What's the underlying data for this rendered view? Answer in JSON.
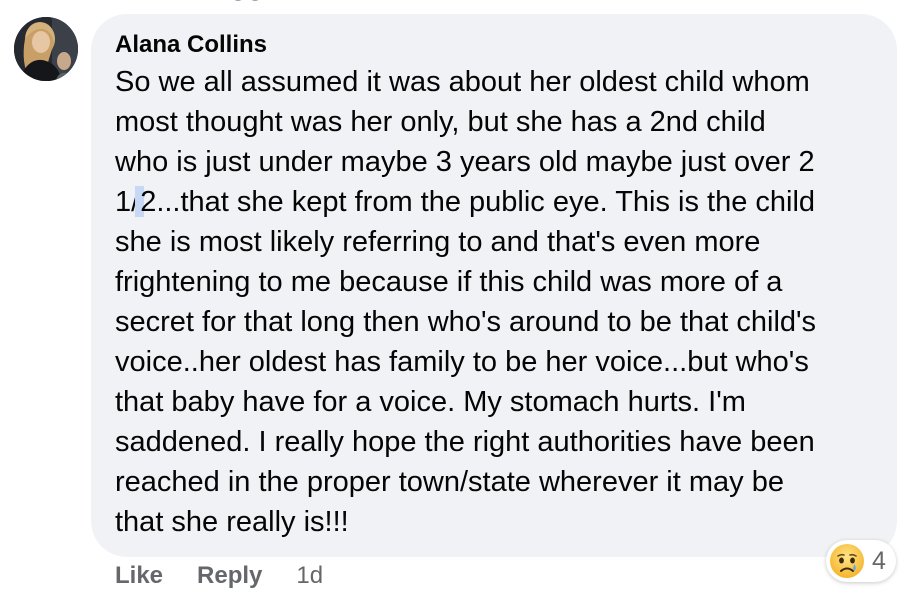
{
  "comment": {
    "author": "Alana Collins",
    "text_lines": [
      "So we all assumed it was about her oldest child whom",
      "most thought was her only, but she has a 2nd child",
      "who is just under maybe 3 years old maybe just over 2",
      "1/",
      "2...that she kept from the public eye. This is the child",
      "she is most likely referring to and that's even more",
      "frightening to me because if this child was more of a",
      "secret for that long then who's around to be that child's",
      "voice..her oldest has family to be her voice...but who's",
      "that baby have for a voice. My stomach hurts. I'm",
      "saddened. I really hope the right authorities have been",
      "reached in the proper town/state wherever it may be",
      "that she really is!!!"
    ]
  },
  "actions": {
    "like_label": "Like",
    "reply_label": "Reply",
    "timestamp": "1d"
  },
  "reactions": {
    "icon": "sad-face-icon",
    "count": "4"
  },
  "colors": {
    "bubble_background": "#f0f2f5",
    "text": "#050505",
    "secondary_text": "#65676b",
    "selection_highlight": "#c6d8f4"
  }
}
